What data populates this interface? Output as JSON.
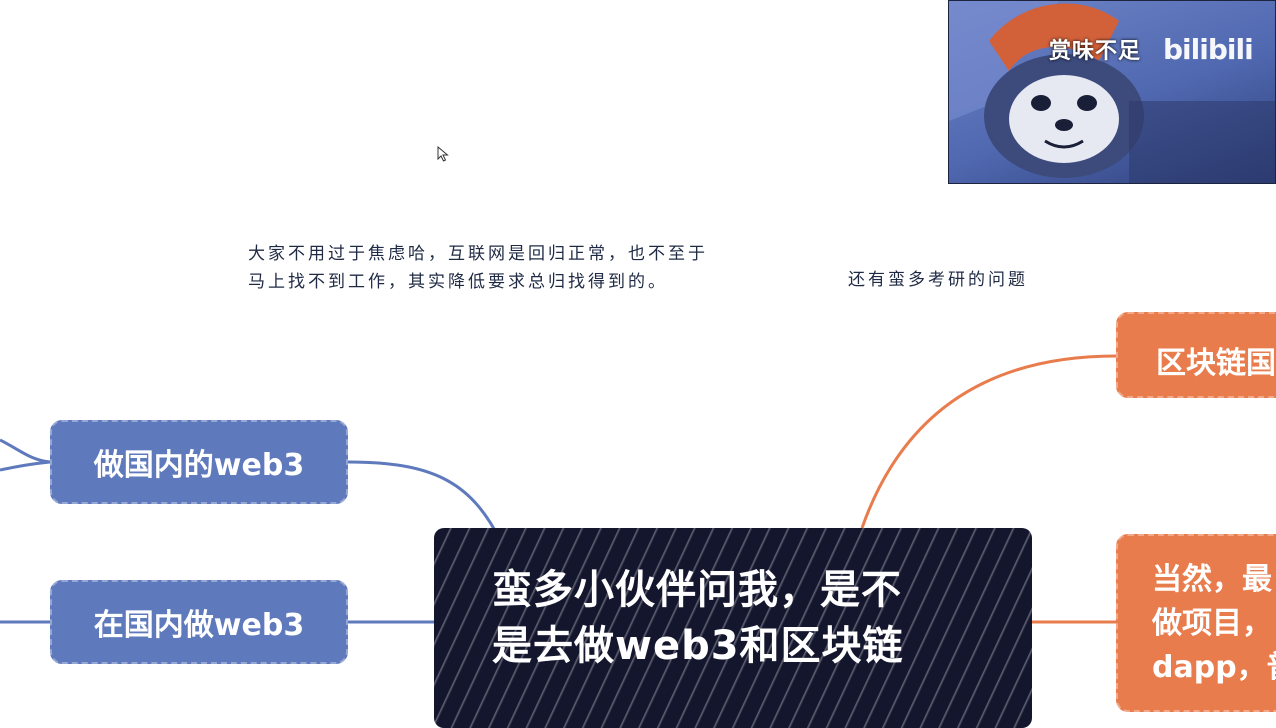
{
  "notes": {
    "left_line1": "大家不用过于焦虑哈，互联网是回归正常，也不至于",
    "left_line2": "马上找不到工作，其实降低要求总归找得到的。",
    "right": "还有蛮多考研的问题"
  },
  "mindmap": {
    "center": {
      "line1": "蛮多小伙伴问我，是不",
      "line2": "是去做web3和区块链"
    },
    "left_nodes": [
      {
        "label": "做国内的web3"
      },
      {
        "label": "在国内做web3"
      }
    ],
    "right_nodes": [
      {
        "label": "区块链国"
      },
      {
        "line1": "当然，最",
        "line2": "做项目，",
        "line3": "dapp，普"
      }
    ]
  },
  "video_overlay": {
    "caption": "赏味不足",
    "logo": "bilibili"
  },
  "colors": {
    "blue_node": "#5f79bd",
    "orange_node": "#e97c4c",
    "center_node": "#14162e",
    "note_text": "#1f2a44"
  },
  "icons": {
    "cursor": "arrow-cursor-icon"
  }
}
